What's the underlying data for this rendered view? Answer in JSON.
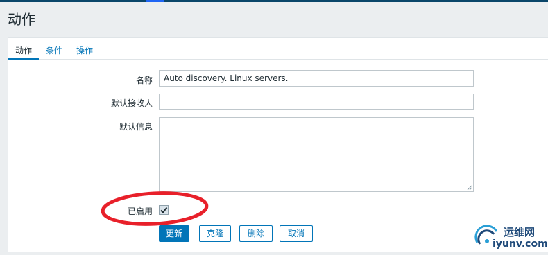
{
  "page": {
    "title": "动作"
  },
  "tabs": [
    {
      "label": "动作",
      "active": true
    },
    {
      "label": "条件",
      "active": false
    },
    {
      "label": "操作",
      "active": false
    }
  ],
  "form": {
    "name_label": "名称",
    "name_value": "Auto discovery. Linux servers.",
    "recipient_label": "默认接收人",
    "recipient_value": "",
    "message_label": "默认信息",
    "message_value": "",
    "enabled_label": "已启用",
    "enabled_checked": true
  },
  "buttons": {
    "update": "更新",
    "clone": "克隆",
    "delete": "删除",
    "cancel": "取消"
  },
  "watermark": {
    "line1": "运维网",
    "line2": "iyunv.com"
  },
  "colors": {
    "accent": "#0275b8",
    "annotation": "#e8202a",
    "header": "#0a466a"
  }
}
